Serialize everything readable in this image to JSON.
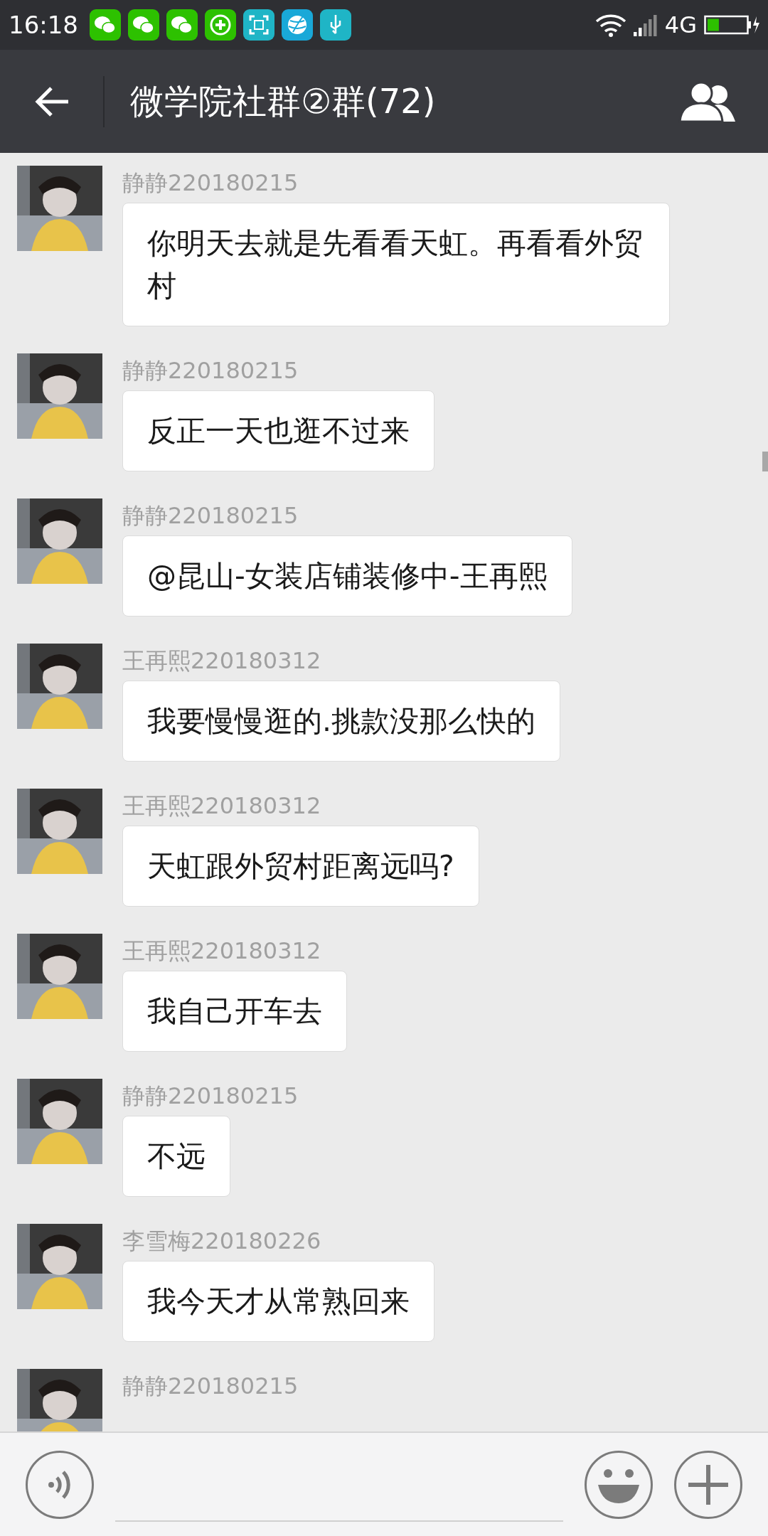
{
  "status_bar": {
    "time": "16:18",
    "network": "4G",
    "notifications": [
      {
        "kind": "chat"
      },
      {
        "kind": "chat"
      },
      {
        "kind": "chat"
      },
      {
        "kind": "plus"
      },
      {
        "kind": "scan"
      },
      {
        "kind": "ball"
      },
      {
        "kind": "usb"
      }
    ],
    "battery": {
      "level": 0.3,
      "charging": true
    }
  },
  "header": {
    "title": "微学院社群②群(72)"
  },
  "messages": [
    {
      "sender": "静静220180215",
      "text": "你明天去就是先看看天虹。再看看外贸村"
    },
    {
      "sender": "静静220180215",
      "text": "反正一天也逛不过来"
    },
    {
      "sender": "静静220180215",
      "text": "@昆山-女装店铺装修中-王再熙"
    },
    {
      "sender": "王再熙220180312",
      "text": "我要慢慢逛的.挑款没那么快的"
    },
    {
      "sender": "王再熙220180312",
      "text": "天虹跟外贸村距离远吗?"
    },
    {
      "sender": "王再熙220180312",
      "text": "我自己开车去"
    },
    {
      "sender": "静静220180215",
      "text": "不远"
    },
    {
      "sender": "李雪梅220180226",
      "text": "我今天才从常熟回来"
    },
    {
      "sender": "静静220180215"
    }
  ]
}
